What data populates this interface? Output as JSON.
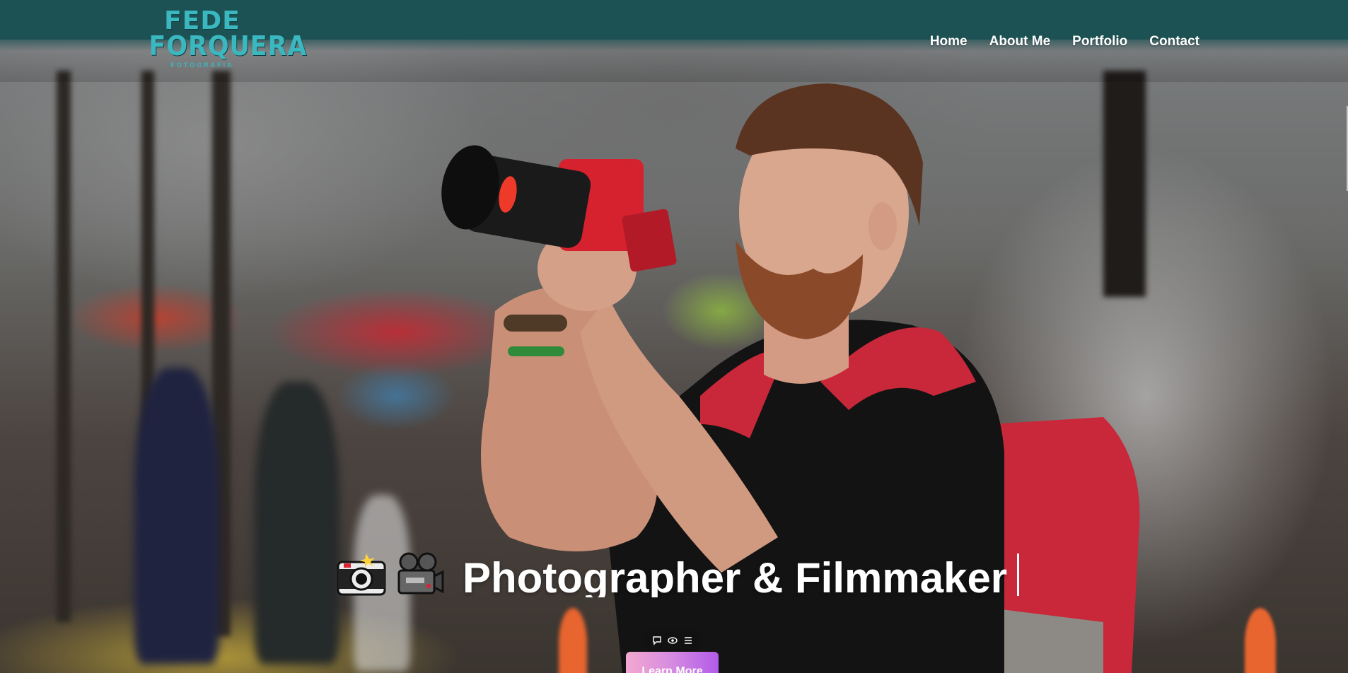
{
  "brand": {
    "line1": "FEDE",
    "line2": "FORQUERA",
    "line3": "FOTOGRAFIA"
  },
  "nav": {
    "items": [
      {
        "label": "Home"
      },
      {
        "label": "About Me"
      },
      {
        "label": "Portfolio"
      },
      {
        "label": "Contact"
      }
    ]
  },
  "hero": {
    "headline": "Photographer & Filmmaker",
    "icons": [
      "camera-with-flash-icon",
      "movie-camera-icon"
    ],
    "cta_label": "Learn More"
  },
  "controls": {
    "icons": [
      "chat-bubble-icon",
      "eye-icon",
      "menu-lines-icon"
    ]
  },
  "colors": {
    "header": "#1c5254",
    "logo": "#3bb7c0",
    "cta_start": "#f4a8d0",
    "cta_end": "#b15be8",
    "text": "#ffffff"
  }
}
